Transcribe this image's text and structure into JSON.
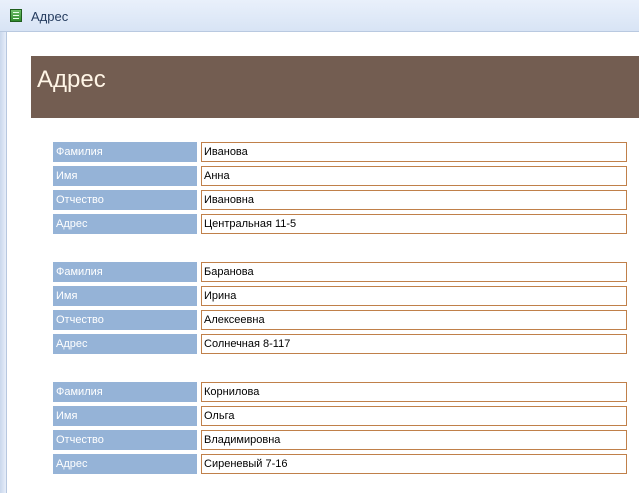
{
  "window": {
    "title": "Адрес",
    "icon": "access-form-icon"
  },
  "header": {
    "title": "Адрес"
  },
  "colors": {
    "header_band": "#735d51",
    "label_background": "#95b3d7",
    "field_border": "#c0804a"
  },
  "records": [
    {
      "fields": [
        {
          "label": "Фамилия",
          "value": "Иванова"
        },
        {
          "label": "Имя",
          "value": "Анна"
        },
        {
          "label": "Отчество",
          "value": "Ивановна"
        },
        {
          "label": "Адрес",
          "value": "Центральная 11-5"
        }
      ]
    },
    {
      "fields": [
        {
          "label": "Фамилия",
          "value": "Баранова"
        },
        {
          "label": "Имя",
          "value": "Ирина"
        },
        {
          "label": "Отчество",
          "value": "Алексеевна"
        },
        {
          "label": "Адрес",
          "value": "Солнечная 8-117"
        }
      ]
    },
    {
      "fields": [
        {
          "label": "Фамилия",
          "value": "Корнилова"
        },
        {
          "label": "Имя",
          "value": "Ольга"
        },
        {
          "label": "Отчество",
          "value": "Владимировна"
        },
        {
          "label": "Адрес",
          "value": "Сиреневый 7-16"
        }
      ]
    }
  ]
}
